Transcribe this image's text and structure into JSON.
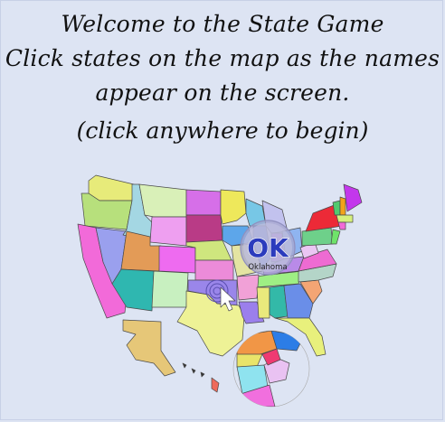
{
  "header": {
    "line1": "Welcome to the State Game",
    "line2": "Click states on the map as the names",
    "line3": "appear on the screen.",
    "start_prompt": "(click anywhere to begin)"
  },
  "badge": {
    "abbr": "OK",
    "state_name": "Oklahoma"
  },
  "icons": {
    "cursor": "arrow-pointer-icon",
    "target": "concentric-rings-icon"
  },
  "colors": {
    "background": "#dde4f3",
    "badge_abbr": "#2b3bbd"
  }
}
